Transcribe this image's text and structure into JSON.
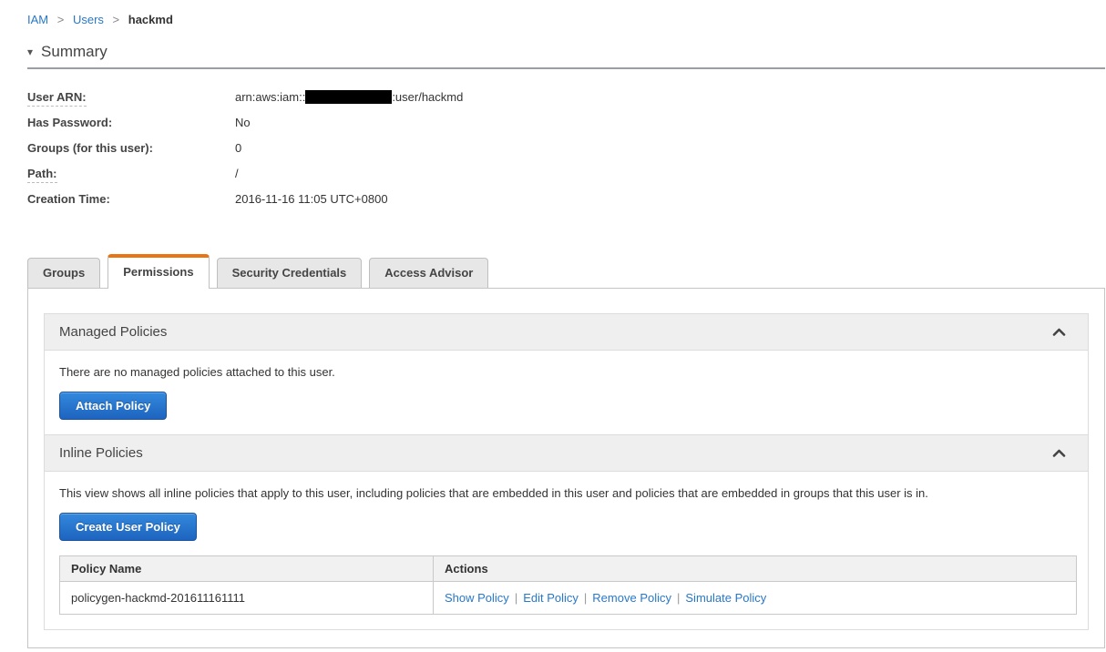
{
  "breadcrumb": {
    "items": [
      "IAM",
      "Users",
      "hackmd"
    ],
    "separator": ">"
  },
  "summary": {
    "collapse_glyph": "▾",
    "title": "Summary",
    "fields": [
      {
        "label": "User ARN:",
        "value_prefix": "arn:aws:iam::",
        "value_suffix": ":user/hackmd",
        "redacted": true
      },
      {
        "label": "Has Password:",
        "value": "No"
      },
      {
        "label": "Groups (for this user):",
        "value": "0"
      },
      {
        "label": "Path:",
        "value": "/"
      },
      {
        "label": "Creation Time:",
        "value": "2016-11-16 11:05 UTC+0800"
      }
    ]
  },
  "tabs": [
    {
      "label": "Groups",
      "active": false
    },
    {
      "label": "Permissions",
      "active": true
    },
    {
      "label": "Security Credentials",
      "active": false
    },
    {
      "label": "Access Advisor",
      "active": false
    }
  ],
  "managed_policies": {
    "title": "Managed Policies",
    "empty_message": "There are no managed policies attached to this user.",
    "attach_button_label": "Attach Policy",
    "collapse_icon": "chevron-up"
  },
  "inline_policies": {
    "title": "Inline Policies",
    "description": "This view shows all inline policies that apply to this user, including policies that are embedded in this user and policies that are embedded in groups that this user is in.",
    "create_button_label": "Create User Policy",
    "collapse_icon": "chevron-up",
    "table": {
      "headers": [
        "Policy Name",
        "Actions"
      ],
      "rows": [
        {
          "policy_name": "policygen-hackmd-201611161111",
          "actions": [
            "Show Policy",
            "Edit Policy",
            "Remove Policy",
            "Simulate Policy"
          ]
        }
      ]
    },
    "actions_separator": "|"
  },
  "colors": {
    "accent_orange": "#e87511",
    "link_blue": "#2878c8",
    "button_gradient_top": "#3389dc",
    "button_gradient_bottom": "#1d64c0",
    "section_header_bg": "#efefef",
    "redaction_black": "#000000"
  }
}
